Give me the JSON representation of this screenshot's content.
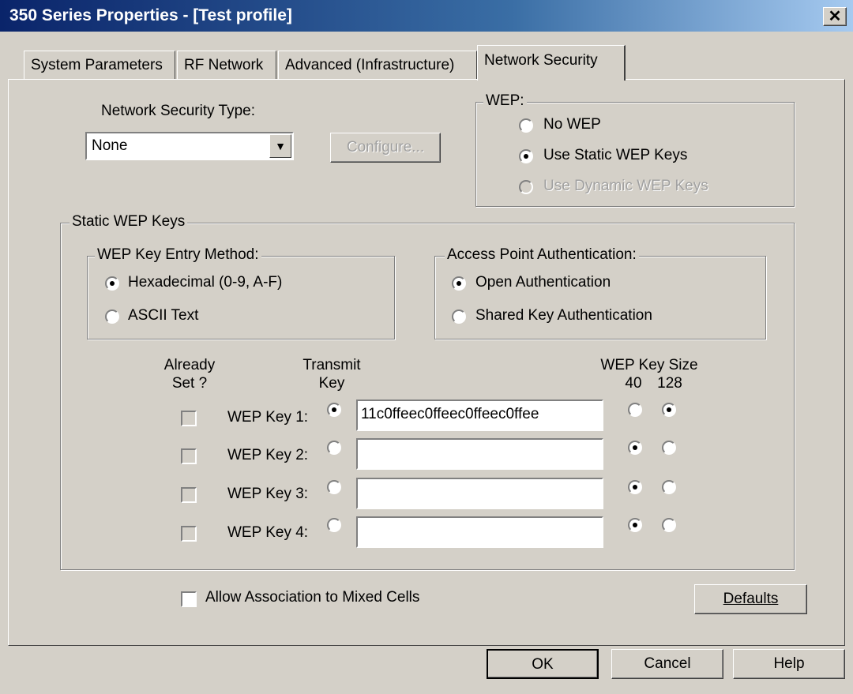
{
  "window": {
    "title": "350 Series Properties - [Test profile]",
    "close_glyph": "✕"
  },
  "tabs": [
    {
      "label": "System Parameters",
      "active": false
    },
    {
      "label": "RF Network",
      "active": false
    },
    {
      "label": "Advanced (Infrastructure)",
      "active": false
    },
    {
      "label": "Network Security",
      "active": true
    }
  ],
  "security_type": {
    "label": "Network Security Type:",
    "value": "None",
    "dropdown_icon": "dropdown-arrow-icon"
  },
  "configure_button": {
    "label": "Configure...",
    "enabled": false
  },
  "wep": {
    "legend": "WEP:",
    "options": [
      {
        "label": "No WEP",
        "selected": false,
        "enabled": true
      },
      {
        "label": "Use Static WEP Keys",
        "selected": true,
        "enabled": true
      },
      {
        "label": "Use Dynamic WEP Keys",
        "selected": false,
        "enabled": false
      }
    ]
  },
  "static_wep": {
    "legend": "Static WEP Keys",
    "entry_method": {
      "legend": "WEP Key Entry Method:",
      "options": [
        {
          "label": "Hexadecimal (0-9, A-F)",
          "selected": true
        },
        {
          "label": "ASCII Text",
          "selected": false
        }
      ]
    },
    "ap_auth": {
      "legend": "Access Point Authentication:",
      "options": [
        {
          "label": "Open Authentication",
          "selected": true
        },
        {
          "label": "Shared Key Authentication",
          "selected": false
        }
      ]
    },
    "headers": {
      "already_set_1": "Already",
      "already_set_2": "Set ?",
      "transmit_1": "Transmit",
      "transmit_2": "Key",
      "key_size": "WEP Key Size",
      "size_40": "40",
      "size_128": "128"
    },
    "keys": [
      {
        "label": "WEP Key 1:",
        "value": "11c0ffeec0ffeec0ffeec0ffee",
        "already_set": false,
        "transmit": true,
        "size": "128"
      },
      {
        "label": "WEP Key 2:",
        "value": "",
        "already_set": false,
        "transmit": false,
        "size": "40"
      },
      {
        "label": "WEP Key 3:",
        "value": "",
        "already_set": false,
        "transmit": false,
        "size": "40"
      },
      {
        "label": "WEP Key 4:",
        "value": "",
        "already_set": false,
        "transmit": false,
        "size": "40"
      }
    ]
  },
  "mixed_cells": {
    "label": "Allow Association to Mixed Cells",
    "checked": false
  },
  "buttons": {
    "defaults": "Defaults",
    "ok": "OK",
    "cancel": "Cancel",
    "help": "Help"
  }
}
